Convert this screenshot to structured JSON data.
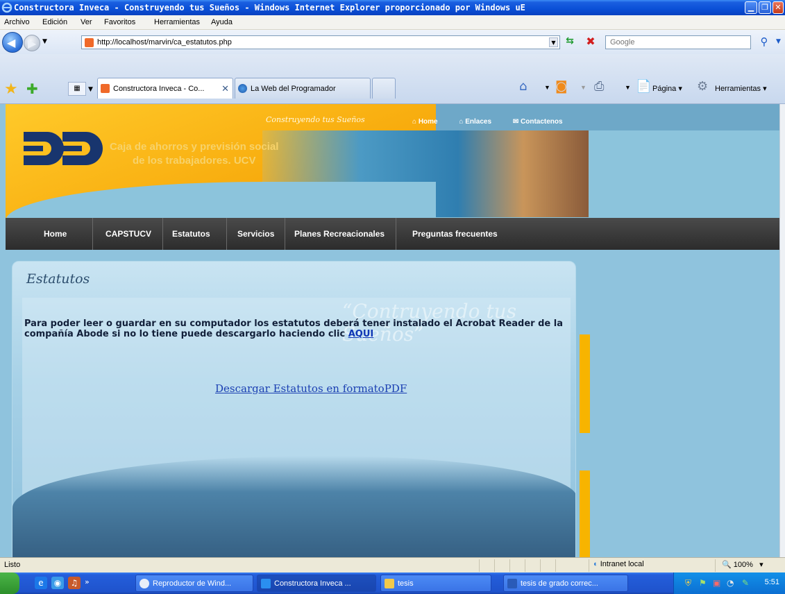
{
  "window": {
    "title": "Constructora Inveca - Construyendo tus Sueños - Windows Internet Explorer proporcionado por Windows uE"
  },
  "menu": [
    "Archivo",
    "Edición",
    "Ver",
    "Favoritos",
    "Herramientas",
    "Ayuda"
  ],
  "address": {
    "url": "http://localhost/marvin/ca_estatutos.php",
    "search_placeholder": "Google"
  },
  "tabs": [
    {
      "label": "Constructora Inveca - Co...",
      "active": true
    },
    {
      "label": "La Web del Programador",
      "active": false
    }
  ],
  "commands": {
    "page": "Página",
    "tools": "Herramientas"
  },
  "site": {
    "slogan": "Construyendo tus Sueños",
    "org_line1": "Caja de ahorros y previsión social",
    "org_line2": "de los trabajadores. UCV",
    "top_links": [
      "Home",
      "Enlaces",
      "Contactenos"
    ],
    "nav": [
      "Home",
      "CAPSTUCV",
      "Estatutos",
      "Servicios",
      "Planes Recreacionales",
      "Preguntas frecuentes"
    ],
    "heading": "Estatutos",
    "bg_slogan": "“Contruyendo tus Sueños”",
    "body_text": "Para poder leer o guardar en su computador los estatutos deberá tener instalado el Acrobat Reader de la compañía Abode si no lo tiene puede descargarlo haciendo clic",
    "body_link": "AQUI",
    "pdf_link": "Descargar Estatutos en formatoPDF"
  },
  "status": {
    "text": "Listo",
    "zone": "Intranet local",
    "zoom": "100%"
  },
  "taskbar": {
    "tasks": [
      "Reproductor de Wind...",
      "Constructora Inveca ...",
      "tesis",
      "tesis de grado correc..."
    ],
    "clock": "5:51"
  },
  "colors": {
    "header_yellow": "#f7a80a",
    "nav_dark": "#2c2c2c",
    "page_blue": "#8fc3dd",
    "accent_bar": "#f7b400"
  }
}
